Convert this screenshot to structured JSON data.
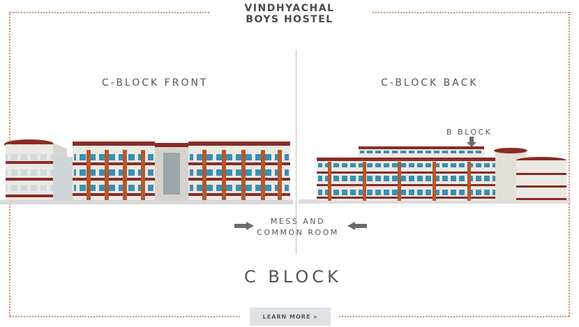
{
  "header": {
    "title_line1": "VINDHYACHAL",
    "title_line2": "BOYS HOSTEL"
  },
  "labels": {
    "front": "C-BLOCK FRONT",
    "back": "C-BLOCK BACK",
    "b_block": "B BLOCK",
    "mess_line1": "MESS AND",
    "mess_line2": "COMMON ROOM",
    "block_name": "C BLOCK"
  },
  "cta": {
    "label": "LEARN MORE »"
  },
  "colors": {
    "frame_dots": "#e8826a",
    "roof": "#8b2a25",
    "wall": "#e9e6e1",
    "window": "#3a8fb0",
    "pillar": "#b5582c",
    "arrow": "#6b6b6b",
    "button_bg": "#dfe2e5"
  },
  "icons": [
    "arrow-down-icon",
    "arrow-right-icon",
    "arrow-left-icon"
  ]
}
